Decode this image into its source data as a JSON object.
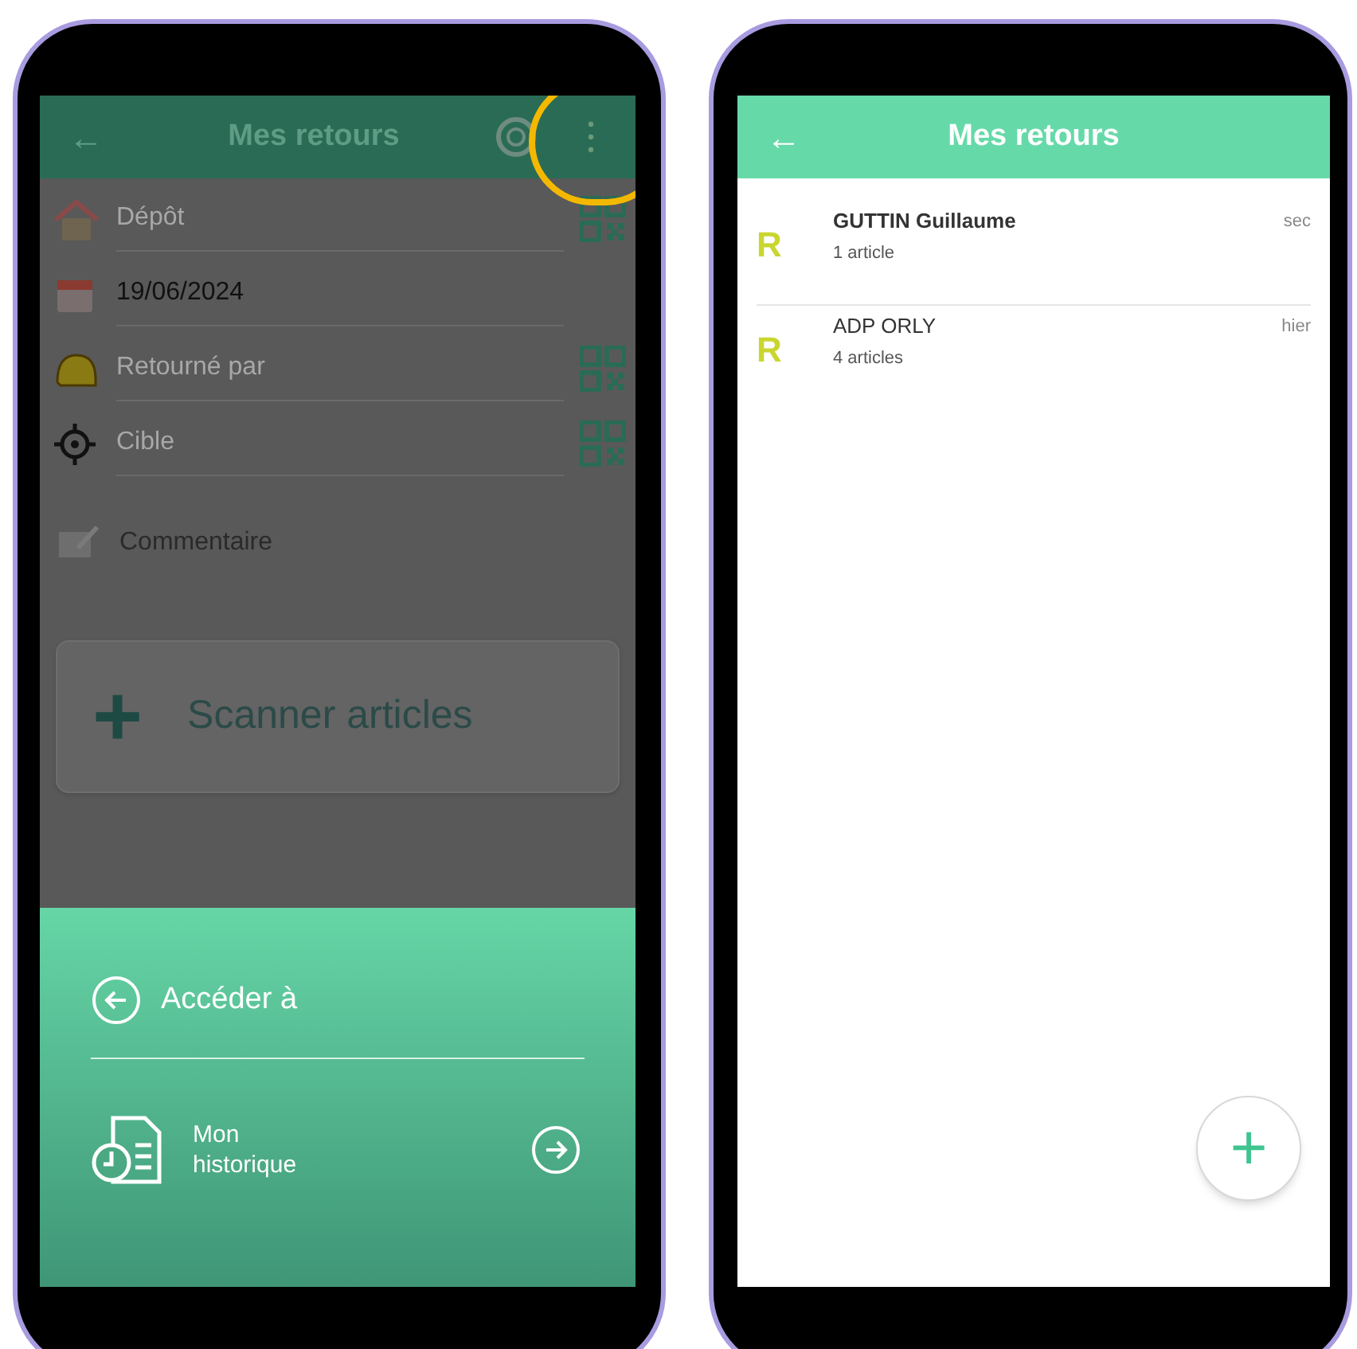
{
  "left_screen": {
    "header": {
      "back": "←",
      "title": "Mes retours",
      "menu_highlighted": true
    },
    "fields": [
      {
        "kind": "house",
        "placeholder": "Dépôt",
        "qr": true
      },
      {
        "kind": "calendar",
        "value": "19/06/2024",
        "qr": false
      },
      {
        "kind": "helmet",
        "placeholder": "Retourné par",
        "qr": true
      },
      {
        "kind": "target",
        "placeholder": "Cible",
        "qr": true
      }
    ],
    "comment": {
      "placeholder": "Commentaire"
    },
    "scan_button": {
      "icon": "+",
      "label": "Scanner articles"
    },
    "bottom_sheet": {
      "title": "Accéder à",
      "items": [
        {
          "label": "Mon historique"
        }
      ]
    }
  },
  "right_screen": {
    "header": {
      "back": "←",
      "title": "Mes retours"
    },
    "returns": [
      {
        "initial": "R",
        "name": "GUTTIN Guillaume",
        "count": "1 article",
        "time": "sec"
      },
      {
        "initial": "R",
        "name": "ADP ORLY",
        "count": "4 articles",
        "time": "hier"
      }
    ],
    "fab": "+"
  }
}
